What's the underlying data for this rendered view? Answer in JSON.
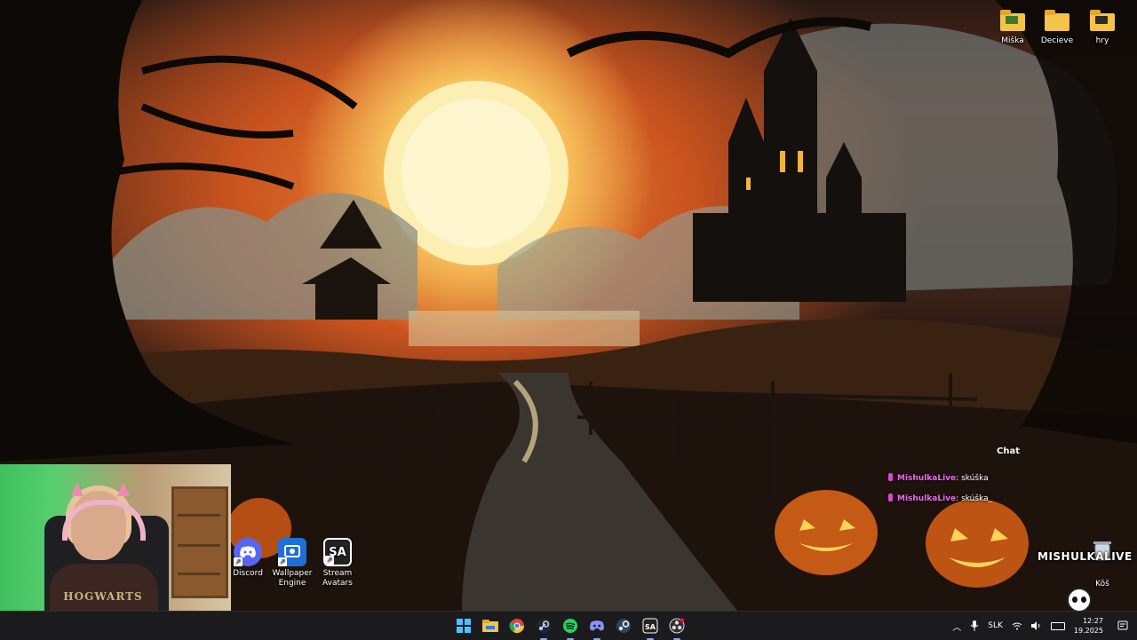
{
  "desktop": {
    "top_icons": [
      {
        "label": "Miška",
        "icon": "folder-icon"
      },
      {
        "label": "Decieve",
        "icon": "folder-icon"
      },
      {
        "label": "hry",
        "icon": "folder-icon"
      }
    ],
    "bottom_icons": [
      {
        "label": "Discord",
        "icon": "discord-icon",
        "color": "#5865f2"
      },
      {
        "label": "Wallpaper Engine",
        "icon": "wallpaper-engine-icon",
        "color": "#1e6fd9"
      },
      {
        "label": "Stream Avatars",
        "icon": "stream-avatars-icon",
        "color": "#1a1a1a"
      }
    ],
    "recycle_bin": {
      "label": "Kôš",
      "icon": "recycle-bin-icon"
    }
  },
  "webcam": {
    "shirt_text": "HOGWARTS"
  },
  "chat": {
    "title": "Chat",
    "messages": [
      {
        "user": "MishulkaLive",
        "text": "skúška"
      },
      {
        "user": "MishulkaLive",
        "text": "skúška_"
      }
    ],
    "user_color": "#e86bf0"
  },
  "stream_overlay": {
    "name": "MISHULKALIVE"
  },
  "taskbar": {
    "apps": [
      {
        "name": "start-icon"
      },
      {
        "name": "file-explorer-icon"
      },
      {
        "name": "chrome-icon"
      },
      {
        "name": "steam-icon"
      },
      {
        "name": "spotify-icon"
      },
      {
        "name": "discord-icon"
      },
      {
        "name": "steam-icon-2"
      },
      {
        "name": "stream-avatars-icon"
      },
      {
        "name": "obs-icon"
      }
    ],
    "tray": {
      "language": "SLK",
      "time": "12:27",
      "date": "19.2025"
    }
  }
}
